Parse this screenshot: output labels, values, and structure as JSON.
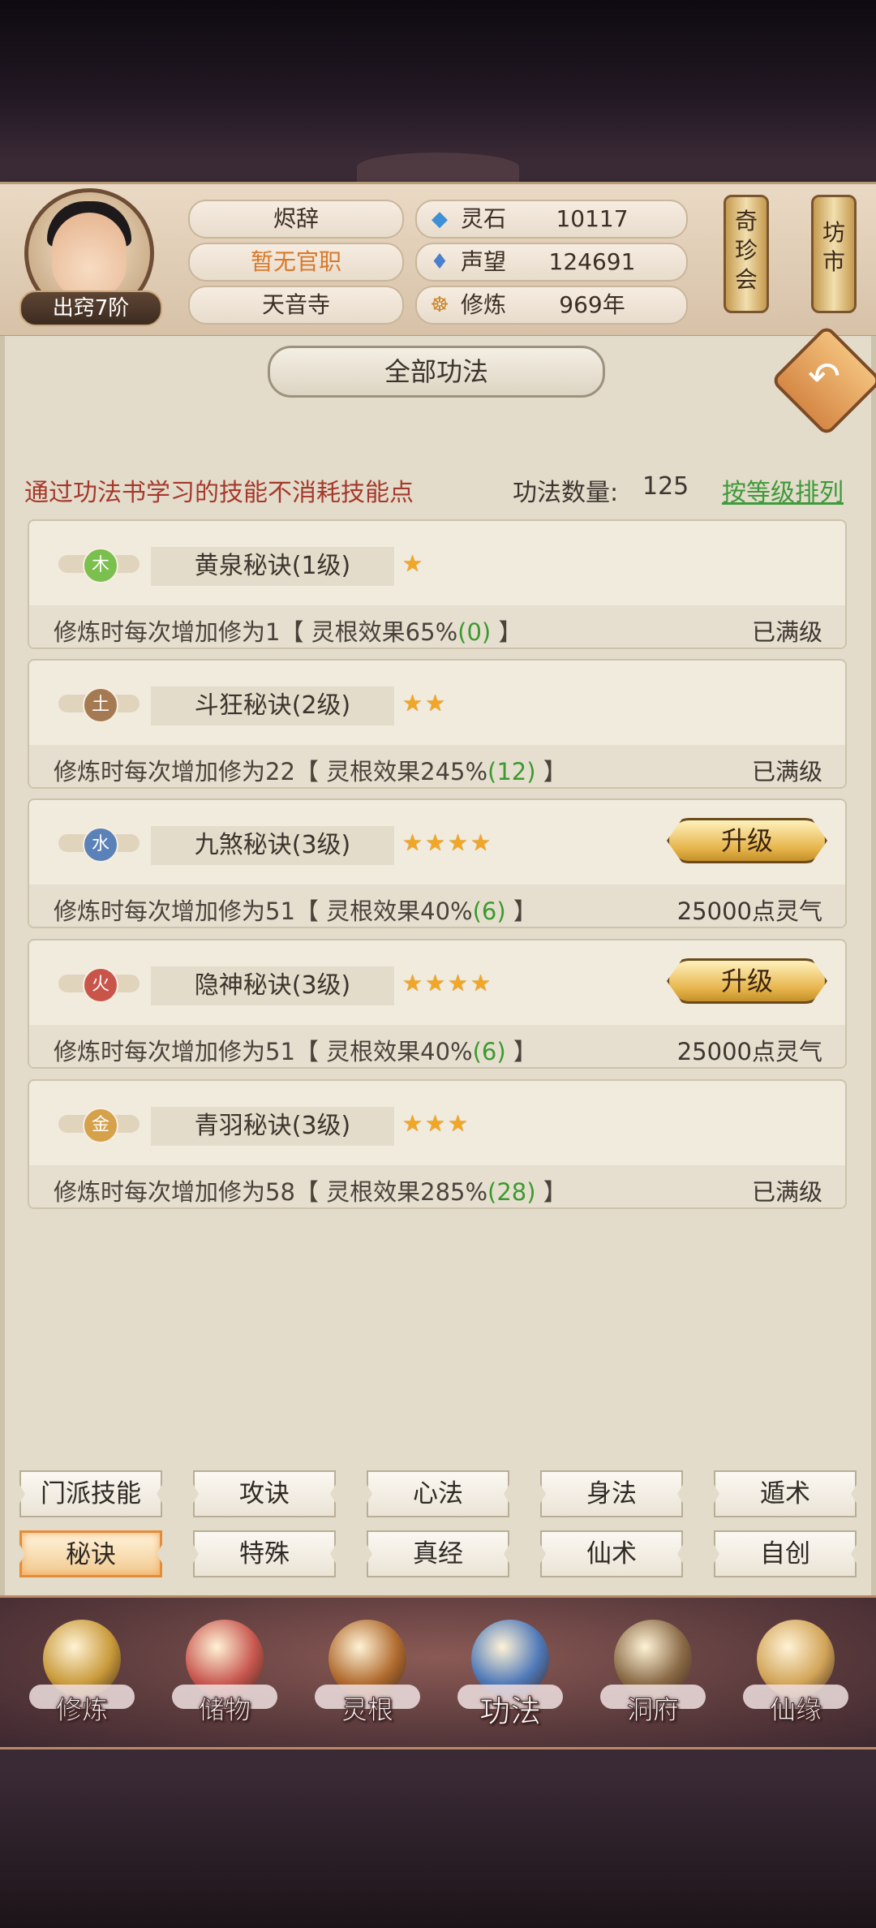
{
  "player": {
    "name": "烬辞",
    "realm": "出窍7阶",
    "official_post": "暂无官职",
    "sect": "天音寺"
  },
  "resources": [
    {
      "icon": "spirit-stone-icon",
      "label": "灵石",
      "value": "10117"
    },
    {
      "icon": "reputation-icon",
      "label": "声望",
      "value": "124691"
    },
    {
      "icon": "meditation-icon",
      "label": "修炼",
      "value": "969年"
    }
  ],
  "side_buttons": {
    "treasure": "奇\n珍\n会",
    "market": "坊\n市"
  },
  "panel": {
    "title": "全部功法",
    "note": "通过功法书学习的技能不消耗技能点",
    "count_label": "功法数量:",
    "count_value": "125",
    "sort_label": "按等级排列"
  },
  "skills": [
    {
      "element": "木",
      "element_color": "#7bbf4e",
      "name": "黄泉秘诀(1级)",
      "stars": 1,
      "desc_main": "修炼时每次增加修为1【 灵根效果65%",
      "desc_bonus": "(0)",
      "desc_end": " 】",
      "status": "已满级",
      "upgrade": null
    },
    {
      "element": "土",
      "element_color": "#a57a52",
      "name": "斗狂秘诀(2级)",
      "stars": 2,
      "desc_main": "修炼时每次增加修为22【 灵根效果245%",
      "desc_bonus": "(12)",
      "desc_end": " 】",
      "status": "已满级",
      "upgrade": null
    },
    {
      "element": "水",
      "element_color": "#5b82b8",
      "name": "九煞秘诀(3级)",
      "stars": 4,
      "desc_main": "修炼时每次增加修为51【 灵根效果40%",
      "desc_bonus": "(6)",
      "desc_end": " 】",
      "status": "25000点灵气",
      "upgrade": "升级"
    },
    {
      "element": "火",
      "element_color": "#c9554a",
      "name": "隐神秘诀(3级)",
      "stars": 4,
      "desc_main": "修炼时每次增加修为51【 灵根效果40%",
      "desc_bonus": "(6)",
      "desc_end": " 】",
      "status": "25000点灵气",
      "upgrade": "升级"
    },
    {
      "element": "金",
      "element_color": "#d5a14a",
      "name": "青羽秘诀(3级)",
      "stars": 3,
      "desc_main": "修炼时每次增加修为58【 灵根效果285%",
      "desc_bonus": "(28)",
      "desc_end": " 】",
      "status": "已满级",
      "upgrade": null
    }
  ],
  "categories": {
    "row1": [
      "门派技能",
      "攻诀",
      "心法",
      "身法",
      "遁术"
    ],
    "row2": [
      "秘诀",
      "特殊",
      "真经",
      "仙术",
      "自创"
    ],
    "active": "秘诀"
  },
  "nav": [
    {
      "label": "修炼",
      "icon": "meditation-figure-icon",
      "color": "#c99a3a"
    },
    {
      "label": "储物",
      "icon": "storage-bag-icon",
      "color": "#c8574f"
    },
    {
      "label": "灵根",
      "icon": "spirit-root-icon",
      "color": "#b06a2e"
    },
    {
      "label": "功法",
      "icon": "skill-book-icon",
      "color": "#4e78b8"
    },
    {
      "label": "洞府",
      "icon": "cave-dwelling-icon",
      "color": "#8a6a46"
    },
    {
      "label": "仙缘",
      "icon": "gourd-icon",
      "color": "#d2a458"
    }
  ],
  "nav_active": "功法"
}
